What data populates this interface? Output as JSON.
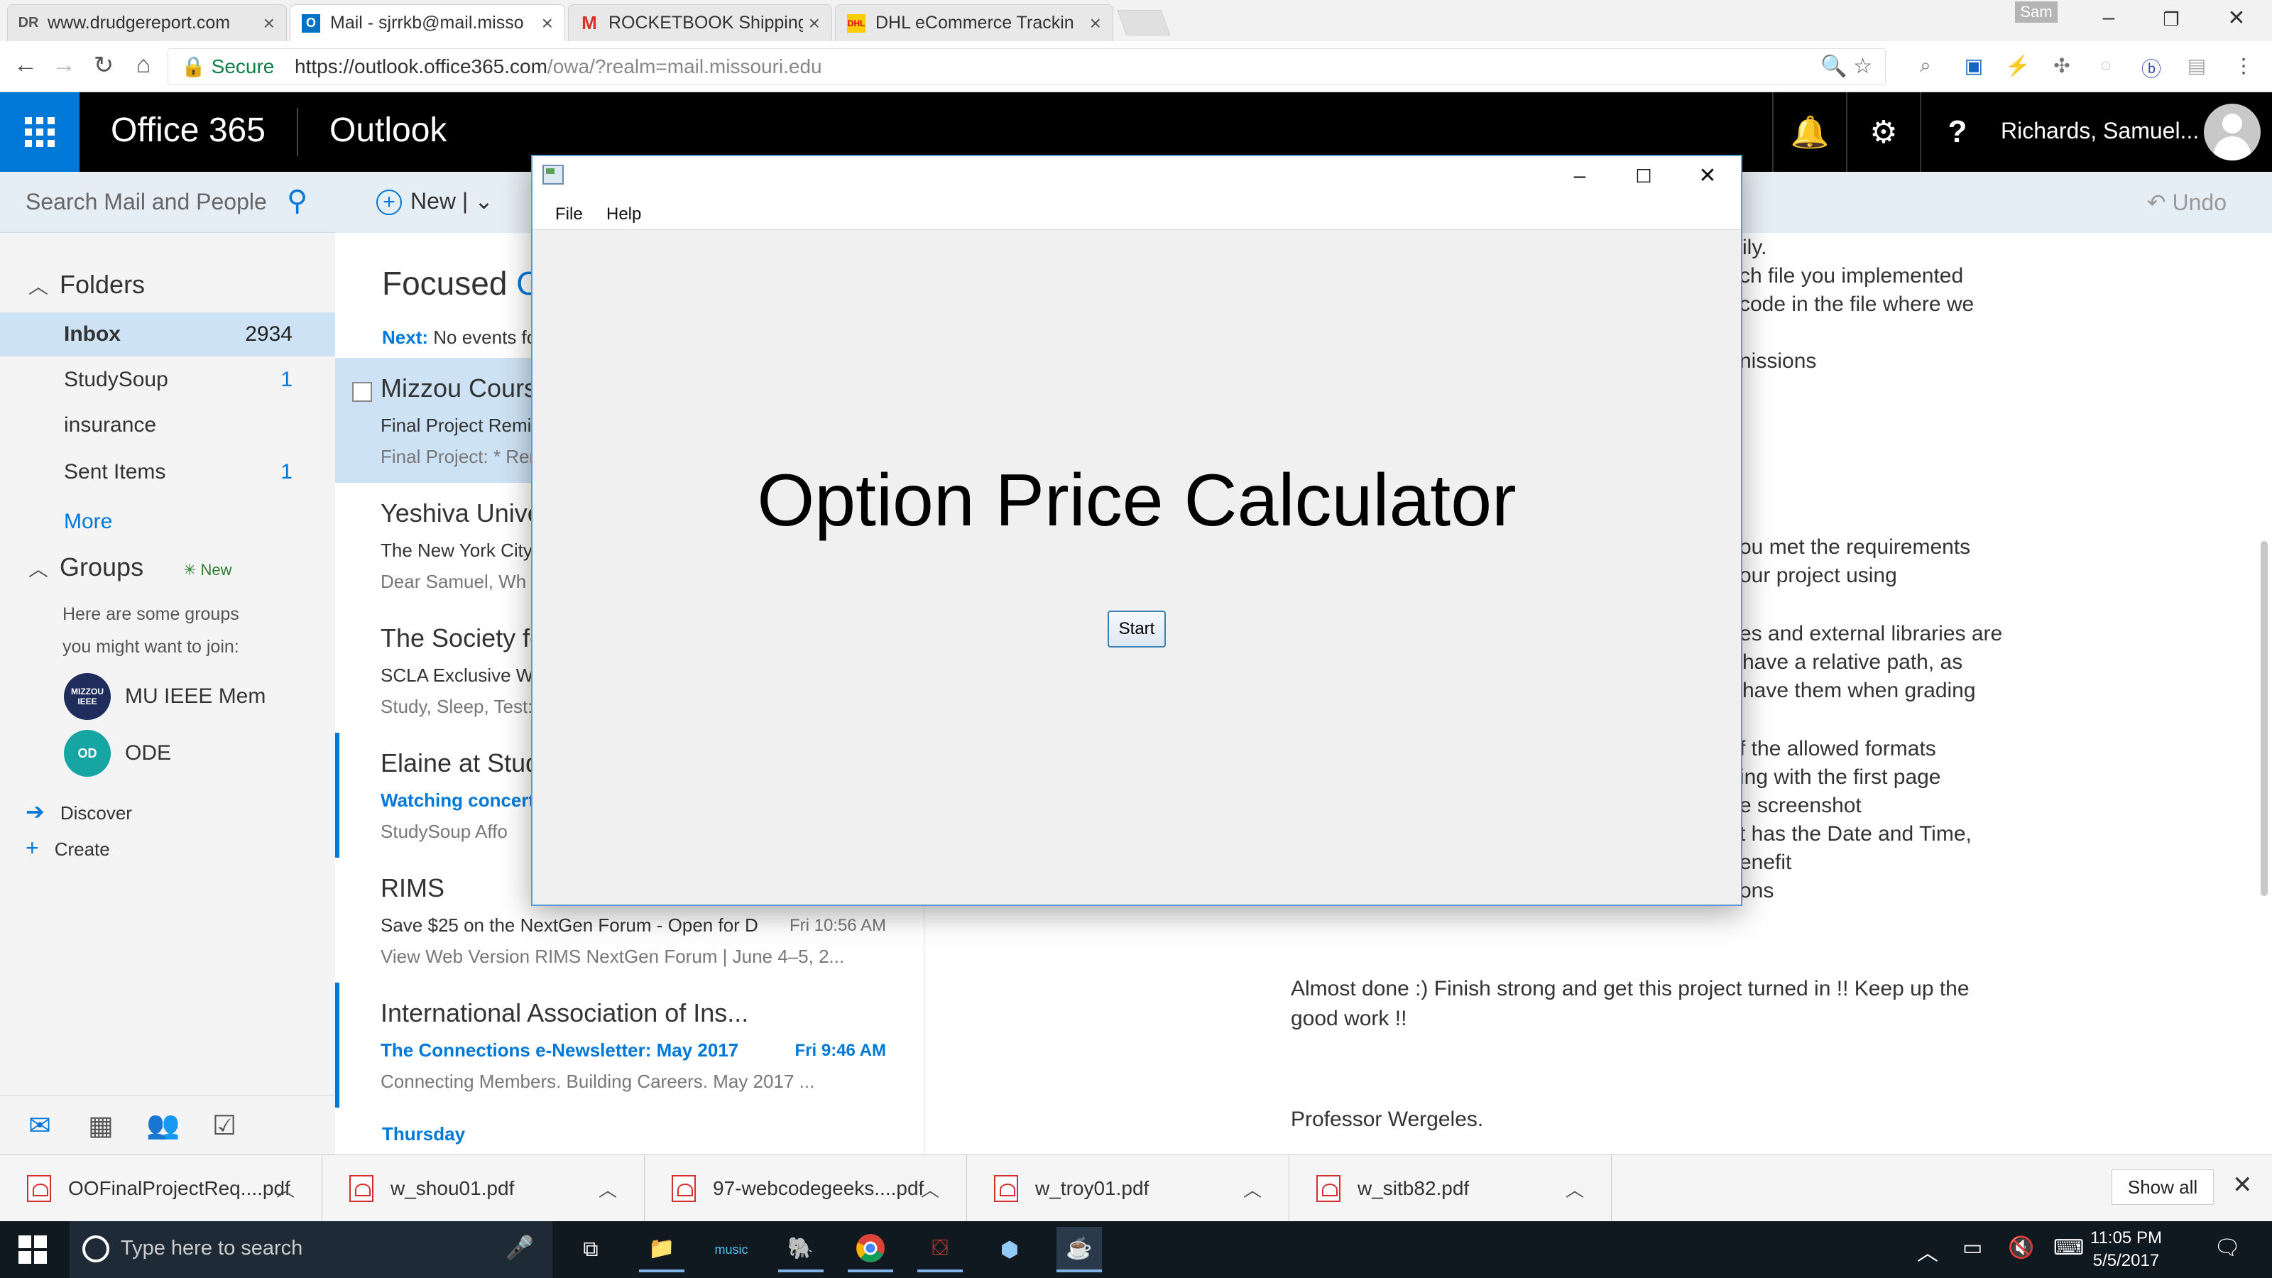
{
  "browser": {
    "tabs": [
      {
        "label": "www.drudgereport.com",
        "icon": "drudge-favicon"
      },
      {
        "label": "Mail - sjrrkb@mail.misso",
        "icon": "outlook-favicon"
      },
      {
        "label": "ROCKETBOOK Shipping C",
        "icon": "gmail-favicon"
      },
      {
        "label": "DHL eCommerce Trackin",
        "icon": "dhl-favicon"
      }
    ],
    "active_tab": 1,
    "profile_name": "Sam",
    "secure_label": "Secure",
    "url_host": "https://outlook.office365.com",
    "url_path": "/owa/?realm=mail.missouri.edu"
  },
  "o365": {
    "brand": "Office 365",
    "app": "Outlook",
    "user_name": "Richards, Samuel..."
  },
  "folders": {
    "search_placeholder": "Search Mail and People",
    "section_label": "Folders",
    "items": [
      {
        "label": "Inbox",
        "count": "2934"
      },
      {
        "label": "StudySoup",
        "count": "1"
      },
      {
        "label": "insurance",
        "count": ""
      },
      {
        "label": "Sent Items",
        "count": "1"
      }
    ],
    "more_label": "More",
    "groups_label": "Groups",
    "groups_new": "New",
    "groups_hint_1": "Here are some groups",
    "groups_hint_2": "you might want to join:",
    "groups": [
      {
        "name": "MU IEEE Mem",
        "initials": "MIZZOU IEEE",
        "color": "#1f2d5c"
      },
      {
        "name": "ODE",
        "initials": "OD",
        "color": "#16a5a3"
      }
    ],
    "discover_label": "Discover",
    "create_label": "Create"
  },
  "messagelist": {
    "new_label": "New",
    "focused_label": "Focused",
    "focused_tail": "O",
    "next_label": "Next:",
    "next_text": "No events fo",
    "messages": [
      {
        "sender": "Mizzou Cours",
        "subject": "Final Project Remin",
        "preview": "Final Project:  * Rem",
        "time": ""
      },
      {
        "sender": "Yeshiva Unive",
        "subject": "The New York City",
        "preview": "Dear Samuel,    Wh",
        "time": ""
      },
      {
        "sender": "The Society fo",
        "subject": "SCLA Exclusive We",
        "preview": "Study, Sleep, Test: T",
        "time": ""
      },
      {
        "sender": "Elaine at Stud",
        "subject": "Watching concert",
        "preview": "StudySoup      Affo",
        "time": ""
      },
      {
        "sender": "RIMS",
        "subject": "Save $25 on the NextGen Forum - Open for D",
        "preview": "View Web Version  RIMS NextGen Forum | June 4–5, 2...",
        "time": "Fri 10:56 AM"
      },
      {
        "sender": "International Association of Ins...",
        "subject": "The Connections e-Newsletter: May 2017",
        "preview": "Connecting Members. Building Careers.      May 2017 ...",
        "time": "Fri 9:46 AM"
      }
    ],
    "day_header": "Thursday"
  },
  "reading": {
    "undo_label": "Undo",
    "lines": [
      "ily.",
      "ch file you implemented",
      "code in the file where we",
      "nissions",
      "ou met the requirements",
      "our project using",
      "es and external libraries are",
      "have a relative path, as",
      "have them when grading",
      "f the allowed formats",
      "ing with the first page",
      "e screenshot",
      "t has the Date and Time,",
      "enefit",
      "ons",
      "Almost done :) Finish strong and get this project turned in !! Keep up the",
      "good work !!",
      "Professor Wergeles."
    ]
  },
  "downloads": {
    "files": [
      "OOFinalProjectReq....pdf",
      "w_shou01.pdf",
      "97-webcodegeeks....pdf",
      "w_troy01.pdf",
      "w_sitb82.pdf"
    ],
    "show_all": "Show all"
  },
  "taskbar": {
    "search_placeholder": "Type here to search",
    "time": "11:05 PM",
    "date": "5/5/2017"
  },
  "dialog": {
    "menu_file": "File",
    "menu_help": "Help",
    "heading": "Option Price Calculator",
    "start_label": "Start"
  },
  "colors": {
    "accent": "#0078d7",
    "header_bg": "#000000",
    "selected_bg": "#cde3f5"
  }
}
